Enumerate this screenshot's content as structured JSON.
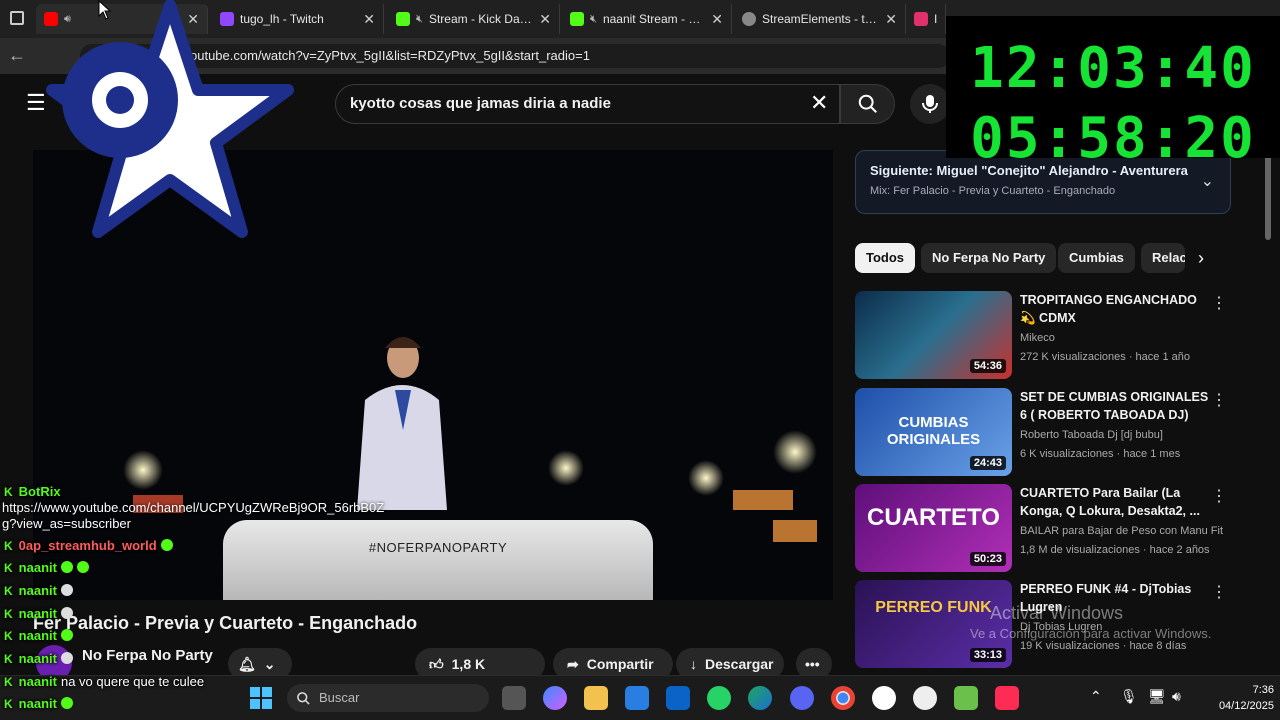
{
  "browser": {
    "tabs": [
      {
        "title": "",
        "favicon_color": "#ff0000",
        "muted": true,
        "active": true
      },
      {
        "title": "tugo_lh - Twitch",
        "favicon_color": "#9146ff",
        "muted": false
      },
      {
        "title": "Stream - Kick Dashboard",
        "favicon_color": "#53fc18",
        "muted": true
      },
      {
        "title": "naanit Stream - Wat",
        "favicon_color": "#53fc18",
        "muted": true
      },
      {
        "title": "StreamElements - tugo_",
        "favicon_color": "#888888",
        "muted": false
      },
      {
        "title": "Ins",
        "favicon_color": "#e1306c",
        "muted": false
      }
    ],
    "url": "outube.com/watch?v=ZyPtvx_5gII&list=RDZyPtvx_5gII&start_radio=1"
  },
  "youtube": {
    "search_query": "kyotto cosas que jamas diria a nadie",
    "video_title": "Fer Palacio - Previa y Cuarteto - Enganchado",
    "channel_name": "No Ferpa No Party",
    "stage_text": "#NOFERPANOPARTY",
    "likes": "1,8 K",
    "share_label": "Compartir",
    "download_label": "Descargar",
    "up_next": {
      "title": "Siguiente: Miguel \"Conejito\" Alejandro - Aventurera",
      "subtitle": "Mix: Fer Palacio - Previa y Cuarteto - Enganchado"
    },
    "chips": [
      "Todos",
      "No Ferpa No Party",
      "Cumbias",
      "Relac"
    ],
    "recommendations": [
      {
        "title": "TROPITANGO ENGANCHADO 💫 CDMX",
        "channel": "Mikeco",
        "meta": "272 K visualizaciones · hace 1 año",
        "duration": "54:36",
        "thumb_text": "",
        "thumb_color": "#1a3a5a"
      },
      {
        "title": "SET DE CUMBIAS ORIGINALES 6 ( ROBERTO TABOADA DJ)",
        "channel": "Roberto Taboada Dj [dj bubu]",
        "meta": "6 K visualizaciones · hace 1 mes",
        "duration": "24:43",
        "thumb_text": "CUMBIAS ORIGINALES",
        "thumb_color": "#1d4fa8"
      },
      {
        "title": "CUARTETO Para Bailar (La Konga, Q Lokura, Desakta2, ...",
        "channel": "BAILAR para Bajar de Peso con Manu Fit",
        "meta": "1,8 M de visualizaciones · hace 2 años",
        "duration": "50:23",
        "thumb_text": "CUARTETO",
        "thumb_color": "#8a1fa8"
      },
      {
        "title": "PERREO FUNK #4 - DjTobias Lugren",
        "channel": "Dj Tobias Lugren",
        "meta": "19 K visualizaciones · hace 8 días",
        "duration": "33:13",
        "thumb_text": "PERREO FUNK",
        "thumb_color": "#3b1c6e"
      }
    ]
  },
  "overlay": {
    "clock_1": "12:03:40",
    "clock_2": "05:58:20",
    "clock_color": "#16e334",
    "chat_link": "https://www.youtube.com/channel/UCPYUgZWReBj9OR_56rbB0Z",
    "chat_link_2": "g?view_as=subscriber",
    "chat": [
      {
        "user": "BotRix",
        "message": "",
        "emotes": 0
      },
      {
        "user": "0ap_streamhub_world",
        "message": "",
        "emotes": 1,
        "red": true
      },
      {
        "user": "naanit",
        "message": "",
        "emotes": 2
      },
      {
        "user": "naanit",
        "message": "",
        "emotes": 1
      },
      {
        "user": "naanit",
        "message": "",
        "emotes": 1
      },
      {
        "user": "naanit",
        "message": "",
        "emotes": 1
      },
      {
        "user": "naanit",
        "message": "",
        "emotes": 1
      },
      {
        "user": "naanit",
        "message": "na vo quere que te culee",
        "emotes": 0
      },
      {
        "user": "naanit",
        "message": "",
        "emotes": 1
      }
    ]
  },
  "watermark": {
    "line1": "Activar Windows",
    "line2": "Ve a Configuración para activar Windows."
  },
  "taskbar": {
    "search_placeholder": "Buscar",
    "time": "7:36",
    "date": "04/12/2025"
  }
}
